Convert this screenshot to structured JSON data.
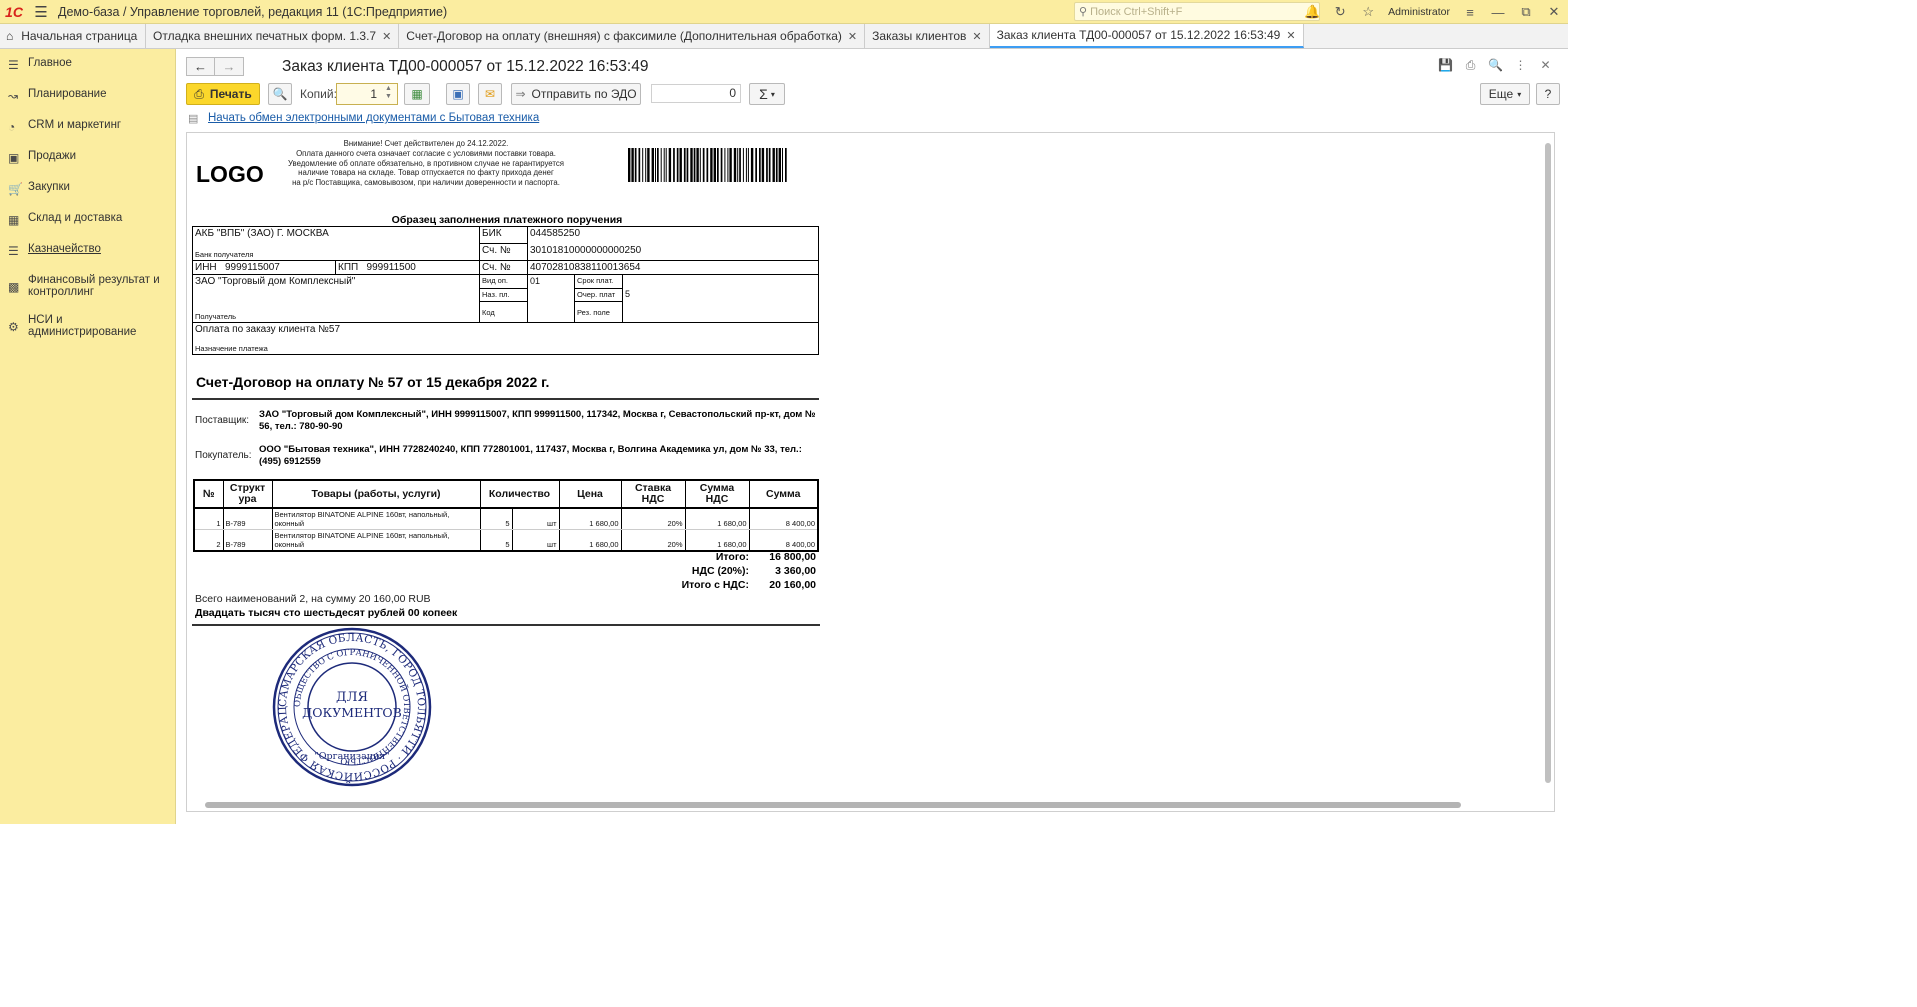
{
  "app": {
    "title": "Демо-база / Управление торговлей, редакция 11  (1С:Предприятие)",
    "search_placeholder": "Поиск Ctrl+Shift+F",
    "user": "Administrator"
  },
  "tabs": [
    {
      "label": "Начальная страница"
    },
    {
      "label": "Отладка внешних печатных форм. 1.3.7"
    },
    {
      "label": "Счет-Договор на оплату (внешняя) с факсимиле (Дополнительная обработка)"
    },
    {
      "label": "Заказы клиентов"
    },
    {
      "label": "Заказ клиента ТД00-000057 от 15.12.2022 16:53:49"
    }
  ],
  "sidebar": {
    "items": [
      {
        "label": "Главное",
        "icon": "menu-icon"
      },
      {
        "label": "Планирование",
        "icon": "planning-icon"
      },
      {
        "label": "CRM и маркетинг",
        "icon": "crm-icon"
      },
      {
        "label": "Продажи",
        "icon": "bag-icon"
      },
      {
        "label": "Закупки",
        "icon": "cart-icon"
      },
      {
        "label": "Склад и доставка",
        "icon": "warehouse-icon"
      },
      {
        "label": "Казначейство",
        "icon": "treasury-icon"
      },
      {
        "label": "Финансовый результат и контроллинг",
        "icon": "chart-icon"
      },
      {
        "label": "НСИ и администрирование",
        "icon": "gear-icon"
      }
    ]
  },
  "form": {
    "title": "Заказ клиента ТД00-000057 от 15.12.2022 16:53:49",
    "print_label": "Печать",
    "copies_label": "Копий:",
    "copies_value": "1",
    "send_edo_label": "Отправить по ЭДО",
    "sum_value": "0",
    "more_label": "Еще",
    "help_label": "?",
    "edo_link": "Начать обмен электронными документами с Бытовая техника"
  },
  "invoice": {
    "logo": "LOGO",
    "notice": [
      "Внимание! Счет действителен до 24.12.2022.",
      "Оплата данного счета означает согласие с условиями поставки товара.",
      "Уведомление об оплате обязательно, в противном случае не гарантируется",
      "наличие товара на складе. Товар отпускается по факту прихода денег",
      "на р/с Поставщика, самовывозом, при наличии доверенности и паспорта."
    ],
    "payment_header": "Образец заполнения платежного поручения",
    "bank_name": "АКБ \"ВПБ\" (ЗАО) Г. МОСКВА",
    "bank_caption": "Банк получателя",
    "bik_label": "БИК",
    "bik": "044585250",
    "corr_label": "Сч. №",
    "corr": "30101810000000000250",
    "inn_label": "ИНН",
    "inn": "9999115007",
    "kpp_label": "КПП",
    "kpp": "999911500",
    "acc_label": "Сч. №",
    "acc": "40702810838110013654",
    "recipient": "ЗАО \"Торговый дом Комплексный\"",
    "recipient_caption": "Получатель",
    "vid_label": "Вид оп.",
    "vid": "01",
    "srok_label": "Срок плат.",
    "naz_label": "Наз. пл.",
    "ocher_label": "Очер. плат",
    "ocher": "5",
    "kod_label": "Код",
    "rez_label": "Рез. поле",
    "purpose": "Оплата по заказу клиента №57",
    "purpose_caption": "Назначение платежа",
    "title": "Счет-Договор на оплату № 57 от 15 декабря 2022 г.",
    "supplier_label": "Поставщик:",
    "supplier": "ЗАО \"Торговый дом Комплексный\", ИНН 9999115007, КПП 999911500, 117342, Москва г, Севастопольский пр-кт, дом № 56, тел.: 780-90-90",
    "buyer_label": "Покупатель:",
    "buyer": "ООО \"Бытовая техника\", ИНН 7728240240, КПП 772801001, 117437, Москва г, Волгина Академика ул, дом № 33, тел.: (495) 6912559",
    "columns": [
      "№",
      "Структ ура",
      "Товары (работы, услуги)",
      "Количество",
      "Цена",
      "Ставка НДС",
      "Сумма НДС",
      "Сумма"
    ],
    "rows": [
      {
        "n": "1",
        "code": "В-789",
        "name": "Вентилятор BINATONE ALPINE 160вт, напольный, оконный",
        "qty": "5",
        "unit": "шт",
        "price": "1 680,00",
        "rate": "20%",
        "vat": "1 680,00",
        "sum": "8 400,00"
      },
      {
        "n": "2",
        "code": "В-789",
        "name": "Вентилятор BINATONE ALPINE 160вт, напольный, оконный",
        "qty": "5",
        "unit": "шт",
        "price": "1 680,00",
        "rate": "20%",
        "vat": "1 680,00",
        "sum": "8 400,00"
      }
    ],
    "total_label": "Итого:",
    "total": "16 800,00",
    "vat_label": "НДС (20%):",
    "vat_total": "3 360,00",
    "grand_label": "Итого с НДС:",
    "grand": "20 160,00",
    "summary": "Всего наименований 2, на сумму 20 160,00 RUB",
    "words": "Двадцать тысяч сто шестьдесят рублей 00 копеек",
    "stamp_outer": "САМАРСКАЯ ОБЛАСТЬ, ГОРОД ТОЛЬЯТТИ · РОССИЙСКАЯ ФЕДЕРАЦИЯ ·",
    "stamp_inner": "ОБЩЕСТВО С ОГРАНИЧЕННОЙ ОТВЕТСТВЕННОСТЬЮ",
    "stamp_line1": "ДЛЯ",
    "stamp_line2": "ДОКУМЕНТОВ",
    "stamp_org": "\"Организация\""
  }
}
